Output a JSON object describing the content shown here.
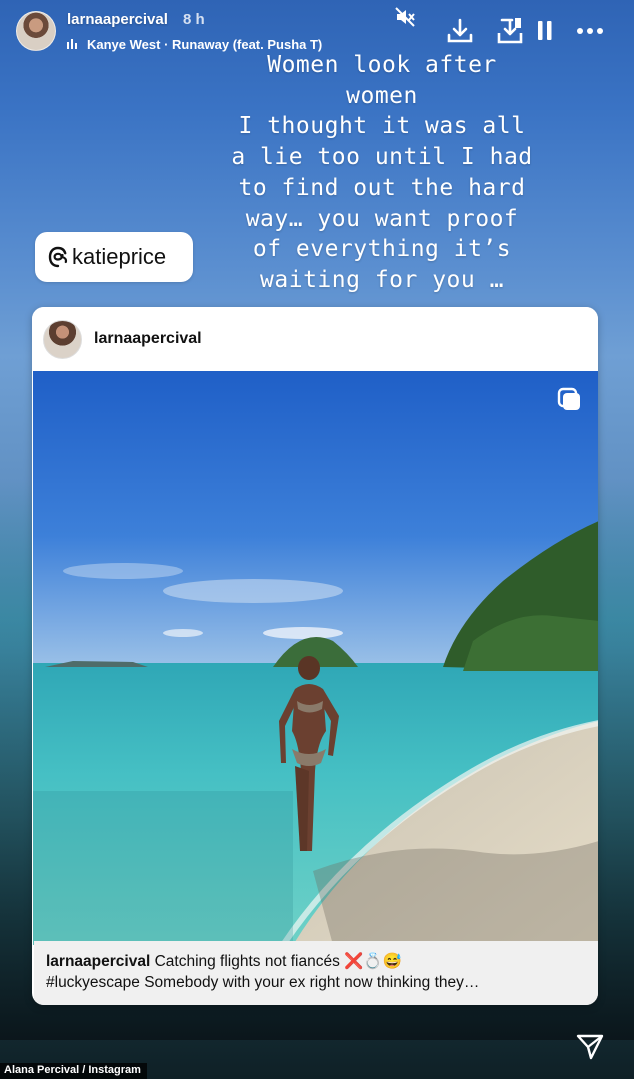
{
  "header": {
    "username": "larnaapercival",
    "time": "8 h",
    "music": "Kanye West · Runaway (feat. Pusha T)",
    "icons": [
      "mute-icon",
      "download-icon",
      "save-icon",
      "pause-icon",
      "more-icon"
    ]
  },
  "story_text": {
    "lines": [
      "Women look after",
      "women",
      "I thought it was all",
      "a lie too until I had",
      "to find out the hard",
      "way… you want proof",
      "of everything it’s",
      "waiting for you …"
    ]
  },
  "mention": {
    "label": "katieprice",
    "icon": "threads-icon"
  },
  "post": {
    "username": "larnaapercival",
    "caption_user": "larnaapercival",
    "caption_line1": " Catching flights not fiancés ❌💍😅",
    "caption_line2": "#luckyescape Somebody with your ex right now thinking they…",
    "multi_icon": "carousel-icon"
  },
  "footer": {
    "credit": "Alana Percival / Instagram",
    "icon": "send-icon"
  }
}
